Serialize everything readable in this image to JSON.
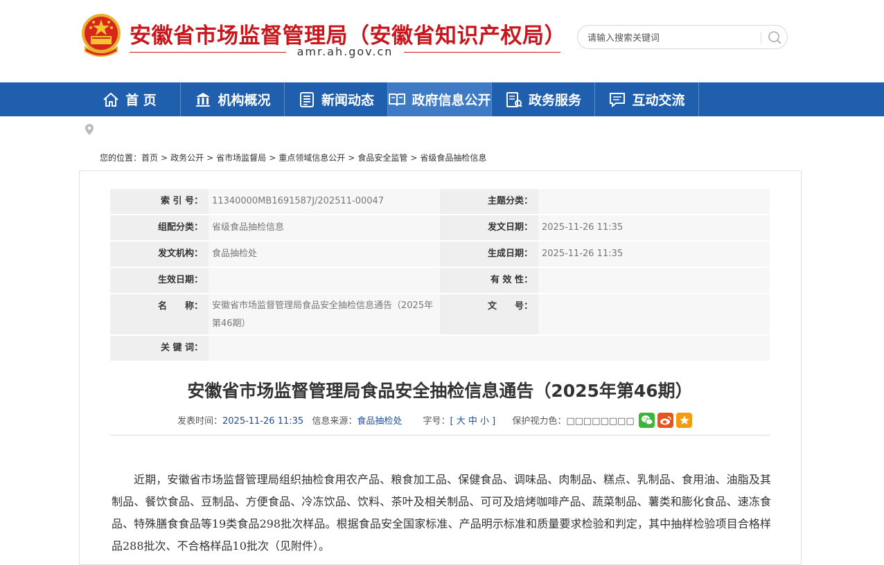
{
  "header": {
    "site_title": "安徽省市场监督管理局（安徽省知识产权局）",
    "site_domain": "amr.ah.gov.cn",
    "search_placeholder": "请输入搜索关键词",
    "brand_color": "#c8161d"
  },
  "nav": {
    "color": "#1f5fae",
    "items": [
      {
        "label": "首 页",
        "icon": "home-icon"
      },
      {
        "label": "机构概况",
        "icon": "building-icon"
      },
      {
        "label": "新闻动态",
        "icon": "news-icon"
      },
      {
        "label": "政府信息公开",
        "icon": "open-book-icon",
        "active": true
      },
      {
        "label": "政务服务",
        "icon": "service-icon"
      },
      {
        "label": "互动交流",
        "icon": "chat-icon"
      }
    ]
  },
  "breadcrumb": {
    "prefix": "您的位置：",
    "items": [
      "首页",
      "政务公开",
      "省市场监督局",
      "重点领域信息公开",
      "食品安全监管",
      "省级食品抽检信息"
    ],
    "separator": ">"
  },
  "meta": {
    "index_label": "索 引 号：",
    "index_value": "11340000MB1691587J/202511-00047",
    "topic_label": "主题分类：",
    "topic_value": "",
    "group_label": "组配分类：",
    "group_value": "省级食品抽检信息",
    "pubdate_label": "发文日期：",
    "pubdate_value": "2025-11-26 11:35",
    "org_label": "发文机构：",
    "org_value": "食品抽检处",
    "gendate_label": "生成日期：",
    "gendate_value": "2025-11-26 11:35",
    "effdate_label": "生效日期：",
    "effdate_value": "",
    "validity_label": "有 效 性：",
    "validity_value": "",
    "name_label": "名　　称：",
    "name_value": "安徽省市场监督管理局食品安全抽检信息通告（2025年第46期）",
    "docno_label": "文　　号：",
    "docno_value": "",
    "keywords_label": "关 键 词：",
    "keywords_value": ""
  },
  "article": {
    "title": "安徽省市场监督管理局食品安全抽检信息通告（2025年第46期）",
    "pubtime_label": "发表时间：",
    "pubtime_value": "2025-11-26 11:35",
    "source_label": "信息来源：",
    "source_value": "食品抽检处",
    "fontsize_label": "字号：",
    "fontsize_value": "[ 大 中 小 ]",
    "eyecolor_label": "保护视力色：",
    "eyecolor_value": "□□□□□□□□",
    "body": "近期，安徽省市场监督管理局组织抽检食用农产品、粮食加工品、保健食品、调味品、肉制品、糕点、乳制品、食用油、油脂及其制品、餐饮食品、豆制品、方便食品、冷冻饮品、饮料、茶叶及相关制品、可可及焙烤咖啡产品、蔬菜制品、薯类和膨化食品、速冻食品、特殊膳食食品等19类食品298批次样品。根据食品安全国家标准、产品明示标准和质量要求检验和判定，其中抽样检验项目合格样品288批次、不合格样品10批次（见附件）。"
  },
  "share": {
    "wechat_color": "#3fb33c",
    "weibo_color": "#e8541e",
    "favorite_color": "#f39c12"
  }
}
